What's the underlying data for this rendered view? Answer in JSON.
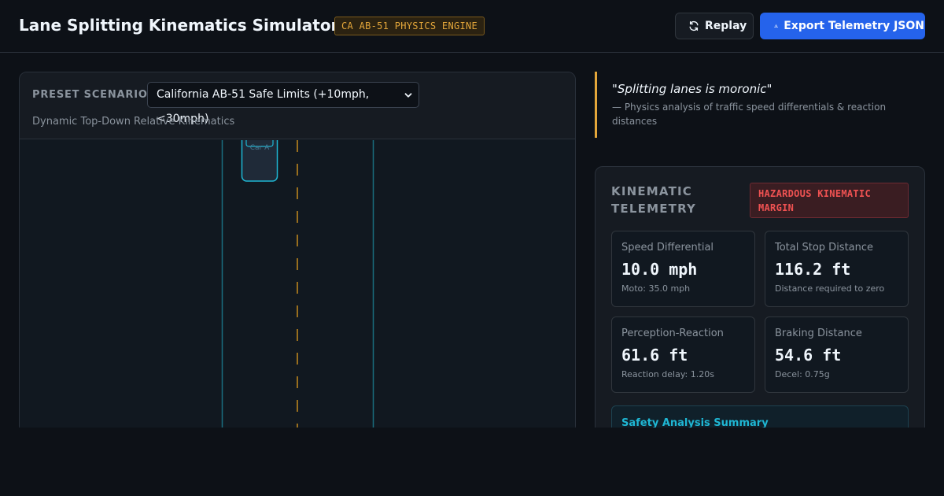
{
  "header": {
    "title": "Lane Splitting Kinematics Simulator",
    "engine_badge": "CA AB-51 PHYSICS ENGINE",
    "replay_label": "Replay",
    "export_label": "Export Telemetry JSON"
  },
  "simulator": {
    "preset_label": "PRESET SCENARIO:",
    "preset_selected": "California AB-51 Safe Limits (+10mph, <30mph)",
    "subtitle": "Dynamic Top-Down Relative Kinematics",
    "car_label": "Car A"
  },
  "quote": {
    "text": "\"Splitting lanes is moronic\"",
    "source": "— Physics analysis of traffic speed differentials & reaction distances"
  },
  "telemetry": {
    "title": "KINEMATIC TELEMETRY",
    "status_badge": "HAZARDOUS KINEMATIC MARGIN",
    "metrics": [
      {
        "label": "Speed Differential",
        "value": "10.0 mph",
        "sub": "Moto: 35.0 mph"
      },
      {
        "label": "Total Stop Distance",
        "value": "116.2 ft",
        "sub": "Distance required to zero"
      },
      {
        "label": "Perception-Reaction",
        "value": "61.6 ft",
        "sub": "Reaction delay: 1.20s"
      },
      {
        "label": "Braking Distance",
        "value": "54.6 ft",
        "sub": "Decel: 0.75g"
      }
    ],
    "summary_title": "Safety Analysis Summary"
  },
  "colors": {
    "accent_blue": "#2563eb",
    "warning_amber": "#e3a63a",
    "hazard_red": "#f05252",
    "lane_cyan": "#1fb6d3"
  }
}
